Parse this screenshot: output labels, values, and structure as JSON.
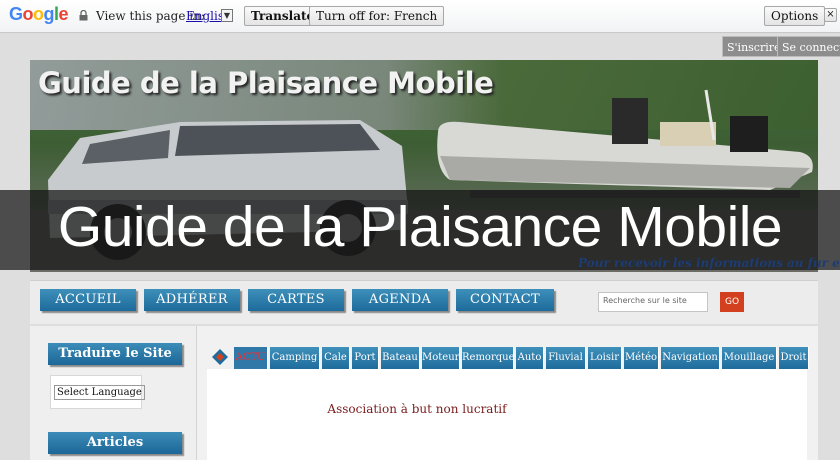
{
  "google_bar": {
    "logo_letters": [
      {
        "ch": "G",
        "color": "#4285f4"
      },
      {
        "ch": "o",
        "color": "#ea4335"
      },
      {
        "ch": "o",
        "color": "#fbbc05"
      },
      {
        "ch": "g",
        "color": "#4285f4"
      },
      {
        "ch": "l",
        "color": "#34a853"
      },
      {
        "ch": "e",
        "color": "#ea4335"
      }
    ],
    "view_text": "View this page in:",
    "language": "English",
    "translate_label": "Translate",
    "turn_off_label": "Turn off for: French",
    "options_label": "Options",
    "close_label": "×"
  },
  "top_buttons": {
    "inscrire": "S'inscrire",
    "connecter": "Se connecter"
  },
  "banner": {
    "title": "Guide de la Plaisance Mobile",
    "subtitle": "Pour recevoir les informations au fur et"
  },
  "overlay_title": "Guide de la Plaisance Mobile",
  "nav": {
    "items": [
      "ACCUEIL",
      "ADHÉRER",
      "CARTES",
      "AGENDA",
      "CONTACT"
    ],
    "search_placeholder": "Recherche sur le site",
    "go_label": "GO"
  },
  "sidebar": {
    "translate_heading": "Traduire le Site",
    "select_language": "Select Language",
    "articles_heading": "Articles"
  },
  "tabs": {
    "active": "ACTU",
    "items": [
      "ACTU",
      "Camping",
      "Cale",
      "Port",
      "Bateau",
      "Moteur",
      "Remorque",
      "Auto",
      "Fluvial",
      "Loisir",
      "Météo",
      "Navigation",
      "Mouillage",
      "Droit"
    ]
  },
  "content": {
    "text": "Association à but non lucratif"
  },
  "colors": {
    "nav_blue": "#1d6b9b",
    "active_tab_text": "#ff2a2a",
    "go_button": "#d2401f"
  }
}
